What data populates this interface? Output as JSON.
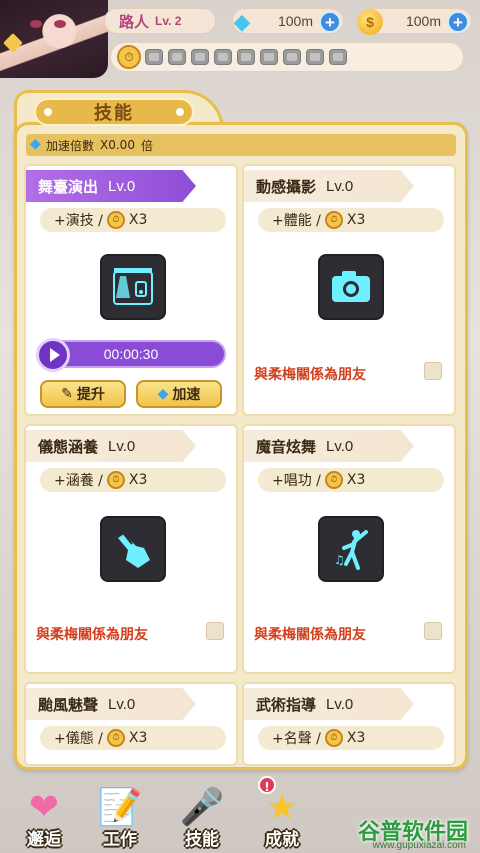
{
  "header": {
    "player_name": "路人",
    "player_level": "Lv. 2",
    "gems": "100m",
    "gold": "100m",
    "stamina_slots": 9
  },
  "panel": {
    "title": "技能",
    "speed_label": "加速倍數",
    "speed_value": "X0.00",
    "speed_unit": "倍"
  },
  "cards": [
    {
      "name": "舞臺演出",
      "level": "Lv.0",
      "stat": "+演技 /",
      "multiplier": "X3",
      "timer": "00:00:30",
      "btn_upgrade": "提升",
      "btn_speedup": "加速"
    },
    {
      "name": "動感攝影",
      "level": "Lv.0",
      "stat": "+體能 /",
      "multiplier": "X3",
      "requirement": "與柔梅關係為朋友"
    },
    {
      "name": "儀態涵養",
      "level": "Lv.0",
      "stat": "+涵養 /",
      "multiplier": "X3",
      "requirement": "與柔梅關係為朋友"
    },
    {
      "name": "魔音炫舞",
      "level": "Lv.0",
      "stat": "+唱功 /",
      "multiplier": "X3",
      "requirement": "與柔梅關係為朋友"
    },
    {
      "name": "颱風魅聲",
      "level": "Lv.0",
      "stat": "+儀態 /",
      "multiplier": "X3"
    },
    {
      "name": "武術指導",
      "level": "Lv.0",
      "stat": "+名聲 /",
      "multiplier": "X3"
    }
  ],
  "nav": [
    {
      "label": "邂逅",
      "icon": "hearts-icon"
    },
    {
      "label": "工作",
      "icon": "notebook-icon"
    },
    {
      "label": "技能",
      "icon": "microphone-icon"
    },
    {
      "label": "成就",
      "icon": "star-icon",
      "badge": "!"
    }
  ],
  "watermark": {
    "text": "谷普软件园",
    "url": "www.gupuxiazai.com"
  },
  "colors": {
    "panel_border": "#e7bf4a",
    "active_title": "#8e4ed6",
    "requirement_text": "#d3401e",
    "gem": "#45c4ef"
  }
}
